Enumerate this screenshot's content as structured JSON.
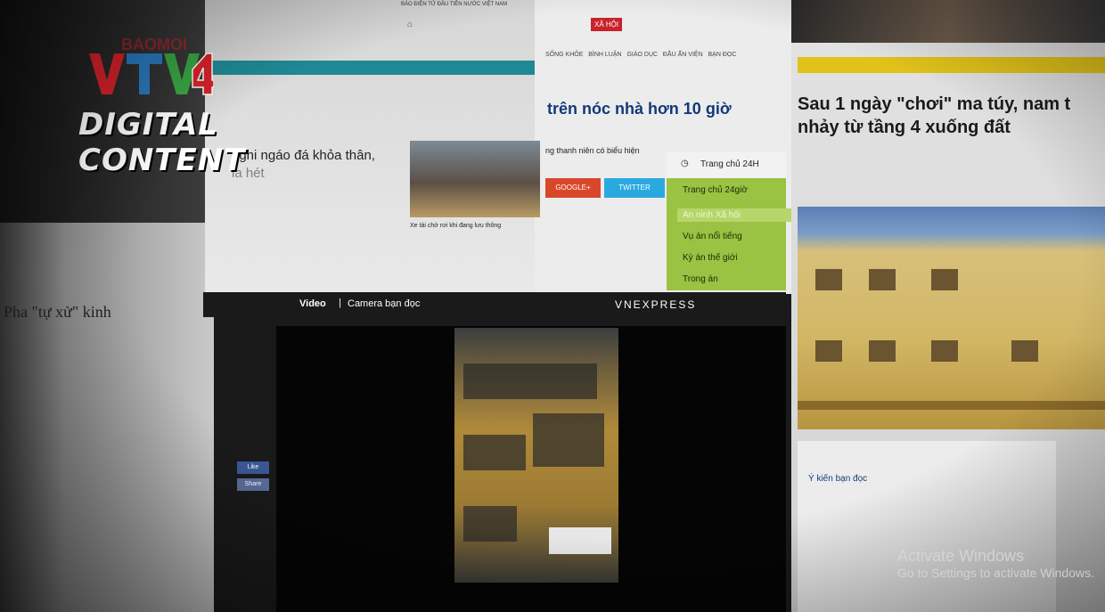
{
  "overlay": {
    "channel_logo_text": "VTV4",
    "digital_line1": "DIGITAL",
    "digital_line2": "CONTENT"
  },
  "baomoi": {
    "site_logo": "BAOMOI",
    "headline_fragment": "nghi ngáo đá khỏa thân,",
    "headline_fragment2": "la hét"
  },
  "vnexpress": {
    "top_banner": "BÁO ĐIỆN TỬ ĐẦU TIÊN NƯỚC VIỆT NAM",
    "menu_active": "XÃ HỘI",
    "headline": "trên nóc nhà hơn 10 giờ",
    "subnav": [
      "SỐNG KHỎE",
      "BÌNH LUẬN",
      "GIÁO DỤC",
      "ĐẦU ẤN VIỆN",
      "BẠN ĐỌC"
    ],
    "article_snippet": "ng thanh niên có biểu hiện",
    "google_btn": "GOOGLE+",
    "twitter_btn": "TWITTER",
    "side_panel_title": "Trang chủ 24H",
    "side_menu": [
      "Trang chủ 24giờ",
      "An ninh Xã hội",
      "Vụ án nổi tiếng",
      "Kỳ án thế giới",
      "Trong án"
    ],
    "video_bar": {
      "video_label": "Video",
      "section_label": "Camera bạn đọc",
      "brand": "VNEXPRESS"
    },
    "like_label": "Like",
    "share_label": "Share"
  },
  "right_site": {
    "headline": "Sau 1 ngày \"chơi\" ma túy, nam t nhảy từ tầng 4 xuống đất",
    "comment_title": "Ý kiến bạn đọc"
  },
  "left_site": {
    "headline": "Pha \"tự xử\" kinh"
  },
  "truck_caption": "Xe tải chở rơi khi đang lưu thông",
  "os_watermark": {
    "line1": "Activate Windows",
    "line2": "Go to Settings to activate Windows."
  }
}
